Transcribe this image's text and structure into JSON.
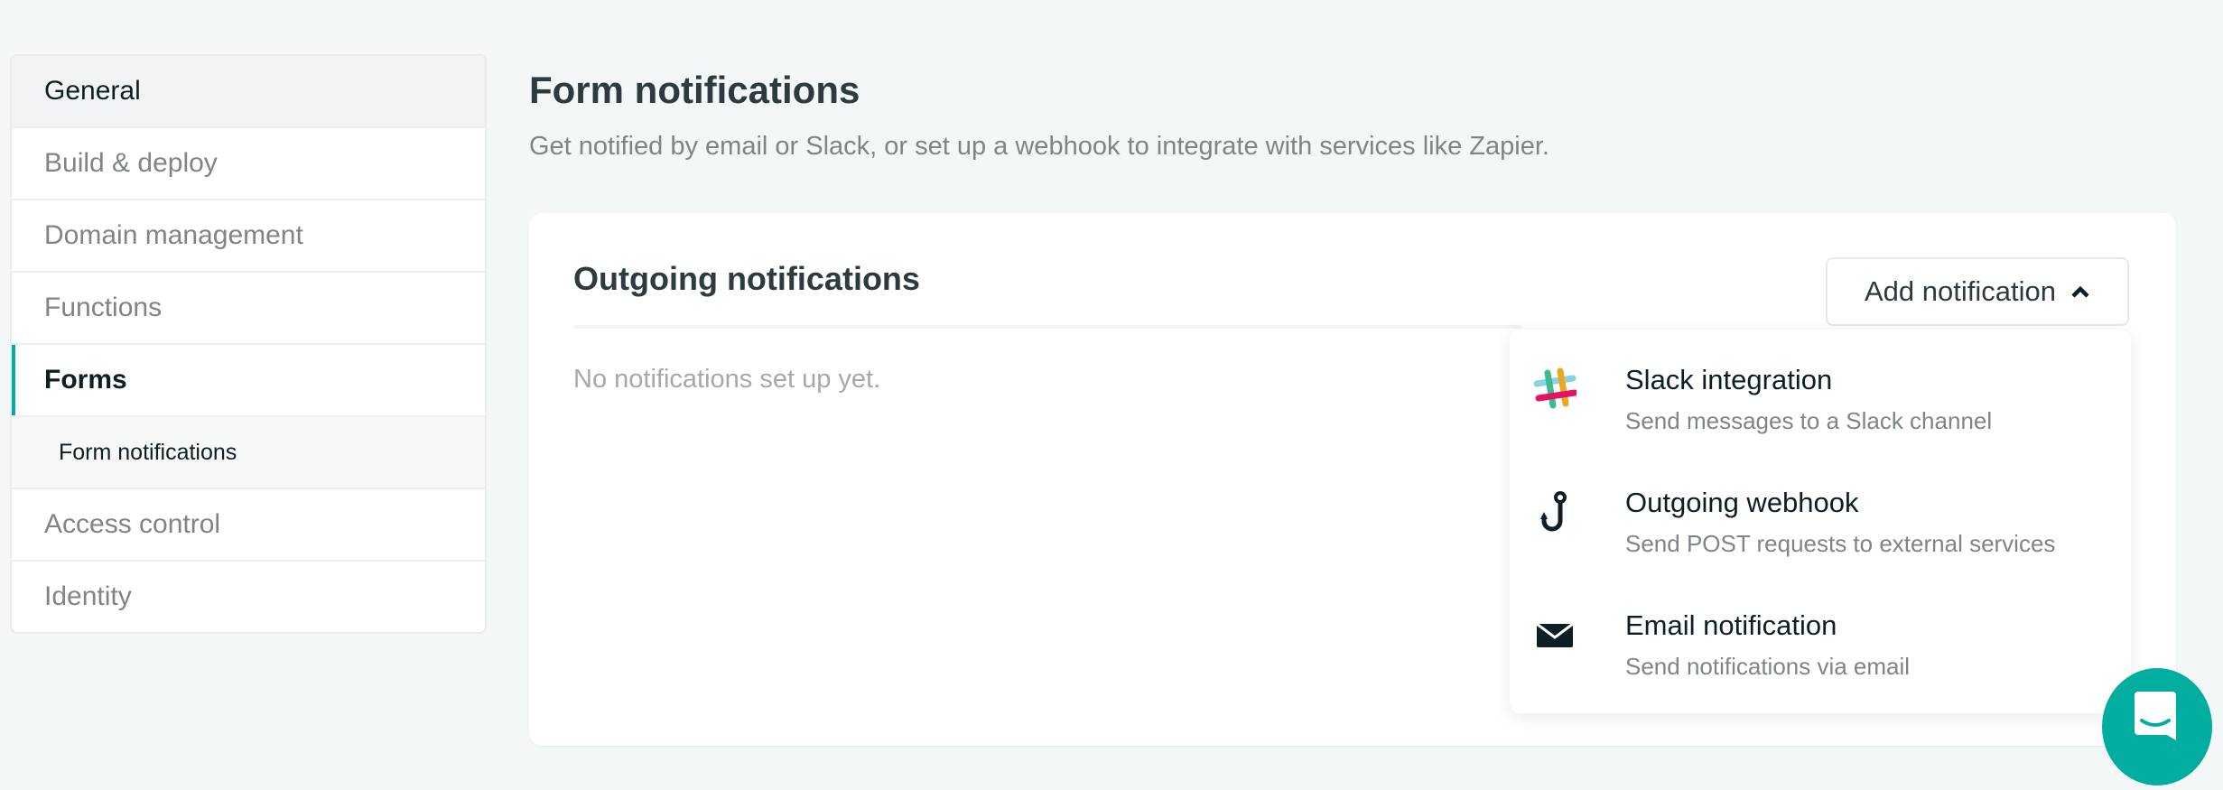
{
  "sidebar": {
    "items": [
      {
        "label": "General"
      },
      {
        "label": "Build & deploy"
      },
      {
        "label": "Domain management"
      },
      {
        "label": "Functions"
      },
      {
        "label": "Forms"
      },
      {
        "label": "Form notifications"
      },
      {
        "label": "Access control"
      },
      {
        "label": "Identity"
      }
    ]
  },
  "header": {
    "title": "Form notifications",
    "subtitle": "Get notified by email or Slack, or set up a webhook to integrate with services like Zapier."
  },
  "card": {
    "title": "Outgoing notifications",
    "empty_text": "No notifications set up yet.",
    "add_button": "Add notification"
  },
  "dropdown": {
    "items": [
      {
        "icon": "slack-icon",
        "title": "Slack integration",
        "description": "Send messages to a Slack channel"
      },
      {
        "icon": "webhook-hook-icon",
        "title": "Outgoing webhook",
        "description": "Send POST requests to external services"
      },
      {
        "icon": "envelope-icon",
        "title": "Email notification",
        "description": "Send notifications via email"
      }
    ]
  },
  "colors": {
    "accent": "#00ad9f",
    "background": "#f4f7f8",
    "text": "#0e1e25",
    "muted": "#7d8589"
  }
}
